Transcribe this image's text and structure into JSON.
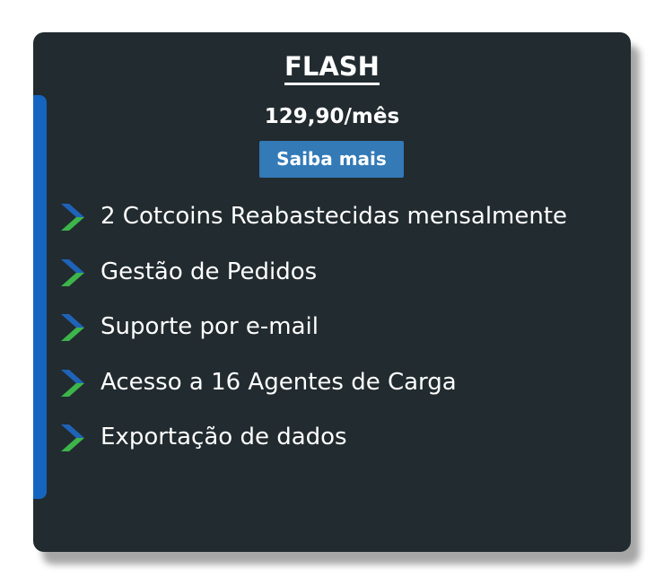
{
  "plan": {
    "title": "FLASH",
    "price": "129,90/mês",
    "cta_label": "Saiba mais",
    "features": [
      {
        "label": "2 Cotcoins Reabastecidas mensalmente",
        "icon": "chevron-right-icon"
      },
      {
        "label": "Gestão de Pedidos",
        "icon": "chevron-right-icon"
      },
      {
        "label": "Suporte por e-mail",
        "icon": "chevron-right-icon"
      },
      {
        "label": "Acesso a 16 Agentes de Carga",
        "icon": "chevron-right-icon"
      },
      {
        "label": "Exportação de dados",
        "icon": "chevron-right-icon"
      }
    ]
  },
  "colors": {
    "card_background": "#222b2f",
    "accent_bar": "#1565c0",
    "button": "#337ab7",
    "chevron_top": "#1e63b8",
    "chevron_bottom": "#3cb54a",
    "text": "#ffffff"
  }
}
